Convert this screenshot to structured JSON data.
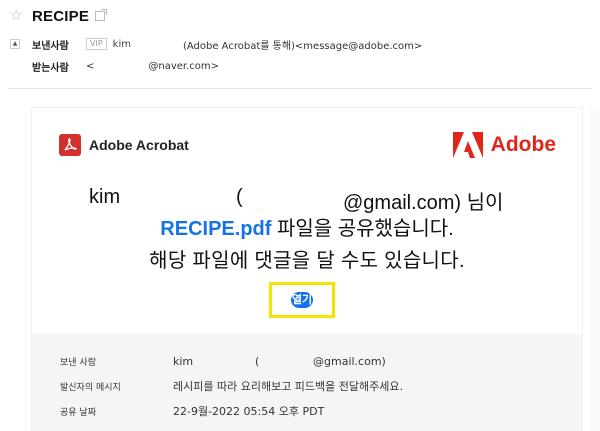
{
  "mail": {
    "subject": "RECIPE",
    "from_label": "보낸사람",
    "vip": "VIP",
    "sender_name": "kim",
    "sender_address": "(Adobe Acrobat를 통해)<message@adobe.com>",
    "to_label": "받는사람",
    "to_open": "<",
    "to_address": "@naver.com>"
  },
  "card": {
    "acrobat_name": "Adobe Acrobat",
    "adobe_name": "Adobe",
    "message": {
      "name": "kim",
      "paren": "(",
      "email_suffix": "@gmail.com) 님이",
      "file_name": "RECIPE.pdf",
      "shared_text": " 파일을 공유했습니다.",
      "line3": "해당 파일에 댓글을 달 수도 있습니다."
    },
    "open_button": "열기",
    "details": [
      {
        "label": "보낸 사람",
        "name": "kim",
        "paren": "(",
        "value": "@gmail.com)"
      },
      {
        "label": "발신자의 메시지",
        "value": "레시피를 따라 요리해보고 피드백을 전달해주세요."
      },
      {
        "label": "공유 날짜",
        "value": "22-9월-2022 05:54 오후 PDT"
      }
    ]
  },
  "colors": {
    "adobe_red": "#e0251b",
    "acrobat_red": "#d0312d",
    "link_blue": "#1473e6",
    "highlight_yellow": "#f2e600",
    "details_bg": "#f5f5f5"
  },
  "icons": {
    "star": "star-icon",
    "external": "external-link-icon",
    "collapse": "collapse-icon",
    "acrobat": "acrobat-logo-icon",
    "adobe": "adobe-logo-icon"
  }
}
